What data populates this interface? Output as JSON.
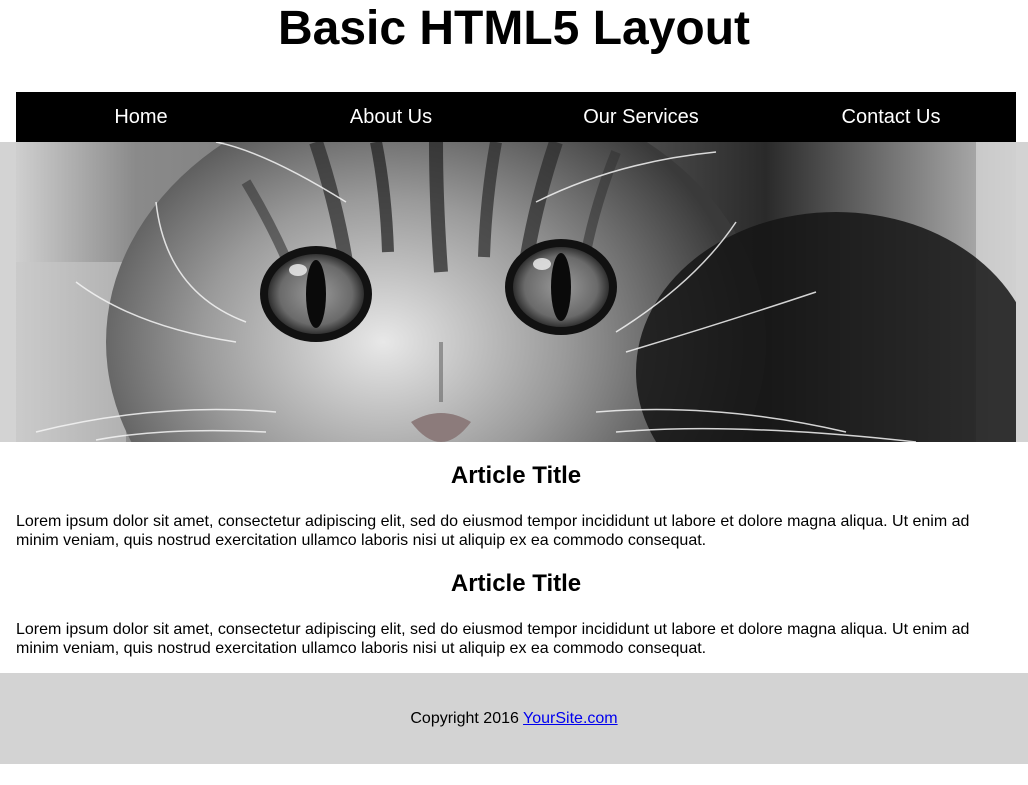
{
  "header": {
    "title": "Basic HTML5 Layout"
  },
  "nav": {
    "items": [
      {
        "label": "Home"
      },
      {
        "label": "About Us"
      },
      {
        "label": "Our Services"
      },
      {
        "label": "Contact Us"
      }
    ]
  },
  "hero": {
    "subject": "kitten-photo"
  },
  "articles": [
    {
      "title": "Article Title",
      "body": "Lorem ipsum dolor sit amet, consectetur adipiscing elit, sed do eiusmod tempor incididunt ut labore et dolore magna aliqua. Ut enim ad minim veniam, quis nostrud exercitation ullamco laboris nisi ut aliquip ex ea commodo consequat."
    },
    {
      "title": "Article Title",
      "body": "Lorem ipsum dolor sit amet, consectetur adipiscing elit, sed do eiusmod tempor incididunt ut labore et dolore magna aliqua. Ut enim ad minim veniam, quis nostrud exercitation ullamco laboris nisi ut aliquip ex ea commodo consequat."
    }
  ],
  "footer": {
    "copyright": "Copyright 2016 ",
    "link_label": "YourSite.com"
  },
  "colors": {
    "nav_bg": "#000000",
    "band_bg": "#d3d3d3",
    "link": "#0000ee"
  }
}
